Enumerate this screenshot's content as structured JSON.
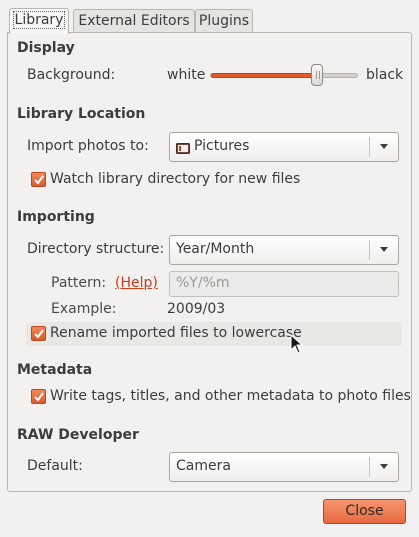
{
  "tabs": [
    {
      "label": "Library",
      "active": true
    },
    {
      "label": "External Editors",
      "active": false
    },
    {
      "label": "Plugins",
      "active": false
    }
  ],
  "display": {
    "heading": "Display",
    "background_label": "Background:",
    "slider_min_label": "white",
    "slider_max_label": "black",
    "slider_value_fraction": 0.72
  },
  "library_location": {
    "heading": "Library Location",
    "import_label": "Import photos to:",
    "import_value": "Pictures",
    "import_icon": "folder-icon",
    "watch_label": "Watch library directory for new files",
    "watch_checked": true
  },
  "importing": {
    "heading": "Importing",
    "dir_structure_label": "Directory structure:",
    "dir_structure_value": "Year/Month",
    "pattern_label": "Pattern:",
    "help_link": "(Help)",
    "pattern_placeholder": "%Y/%m",
    "example_label": "Example:",
    "example_value": "2009/03",
    "rename_label": "Rename imported files to lowercase",
    "rename_checked": true
  },
  "metadata": {
    "heading": "Metadata",
    "write_label": "Write tags, titles, and other metadata to photo files",
    "write_checked": true
  },
  "raw_developer": {
    "heading": "RAW Developer",
    "default_label": "Default:",
    "default_value": "Camera"
  },
  "close_button": "Close",
  "colors": {
    "accent": "#e55a2b",
    "link": "#c6401d",
    "window_bg": "#f2f1f0"
  }
}
